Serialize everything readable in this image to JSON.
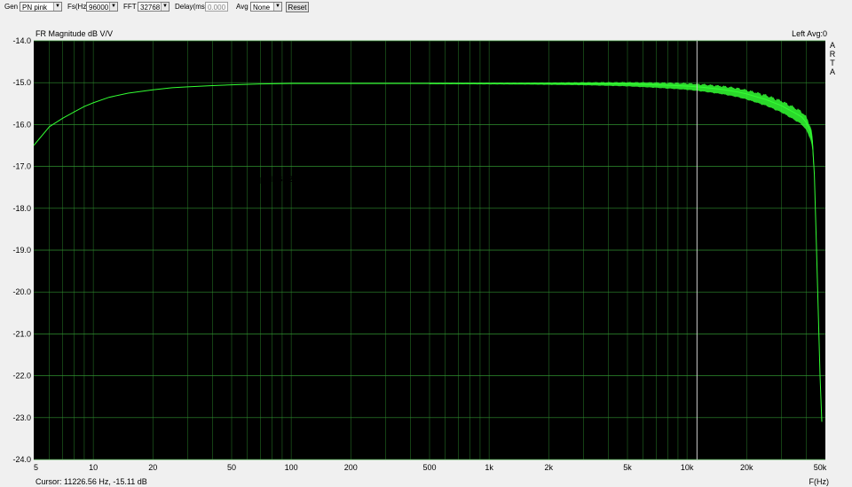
{
  "toolbar": {
    "gen_label": "Gen",
    "gen_value": "PN pink",
    "fs_label": "Fs(Hz)",
    "fs_value": "96000",
    "fft_label": "FFT",
    "fft_value": "32768",
    "delay_label": "Delay(ms)",
    "delay_value": "0.000",
    "avg_label": "Avg",
    "avg_value": "None",
    "reset_label": "Reset"
  },
  "plot": {
    "background": "#000000",
    "grid_color": "#2f8f2f",
    "trace_color": "#33ff33",
    "annotation_color": "#ffff33",
    "cursor_color": "#d0d0d0",
    "channel_label": "Left  Avg:0",
    "brand": [
      "A",
      "R",
      "T",
      "A"
    ],
    "cursor_readout": "Cursor: 11226.56 Hz, -15.11 dB",
    "cursor_x": 11226.56
  },
  "chart_data": {
    "type": "line",
    "title": "FR Magnitude dB V/V",
    "xlabel": "F(Hz)",
    "ylabel": "",
    "xscale": "log",
    "xlim": [
      5,
      50000
    ],
    "ylim": [
      -24.0,
      -14.0
    ],
    "grid": true,
    "xticks": [
      5,
      10,
      20,
      50,
      100,
      200,
      500,
      1000,
      2000,
      5000,
      10000,
      20000,
      50000
    ],
    "xtick_labels": [
      "5",
      "10",
      "20",
      "50",
      "100",
      "200",
      "500",
      "1k",
      "2k",
      "5k",
      "10k",
      "20k",
      "50k"
    ],
    "yticks": [
      -14.0,
      -15.0,
      -16.0,
      -17.0,
      -18.0,
      -19.0,
      -20.0,
      -21.0,
      -22.0,
      -23.0,
      -24.0
    ],
    "ytick_labels": [
      "-14.0",
      "-15.0",
      "-16.0",
      "-17.0",
      "-18.0",
      "-19.0",
      "-20.0",
      "-21.0",
      "-22.0",
      "-23.0",
      "-24.0"
    ],
    "annotations": [
      "Ppy DSD2 V2 new with re clock"
    ],
    "series": [
      {
        "x": [
          5,
          6,
          7,
          8,
          9,
          10,
          12,
          15,
          18,
          20,
          25,
          30,
          40,
          50,
          70,
          100,
          150,
          200,
          300,
          500,
          700,
          1000,
          1500,
          2000,
          3000,
          5000,
          7000,
          10000,
          12000,
          15000,
          18000,
          20000,
          25000,
          30000,
          35000,
          38000,
          40000,
          42000,
          43000,
          44000,
          45000,
          46000,
          47000,
          48000
        ],
        "y": [
          -16.5,
          -16.05,
          -15.85,
          -15.7,
          -15.57,
          -15.48,
          -15.35,
          -15.25,
          -15.2,
          -15.17,
          -15.12,
          -15.1,
          -15.07,
          -15.05,
          -15.03,
          -15.02,
          -15.02,
          -15.02,
          -15.02,
          -15.02,
          -15.02,
          -15.02,
          -15.02,
          -15.02,
          -15.02,
          -15.03,
          -15.05,
          -15.08,
          -15.11,
          -15.16,
          -15.22,
          -15.27,
          -15.4,
          -15.55,
          -15.72,
          -15.82,
          -15.95,
          -16.15,
          -16.4,
          -17.2,
          -18.8,
          -20.4,
          -22.0,
          -23.1
        ]
      }
    ]
  }
}
